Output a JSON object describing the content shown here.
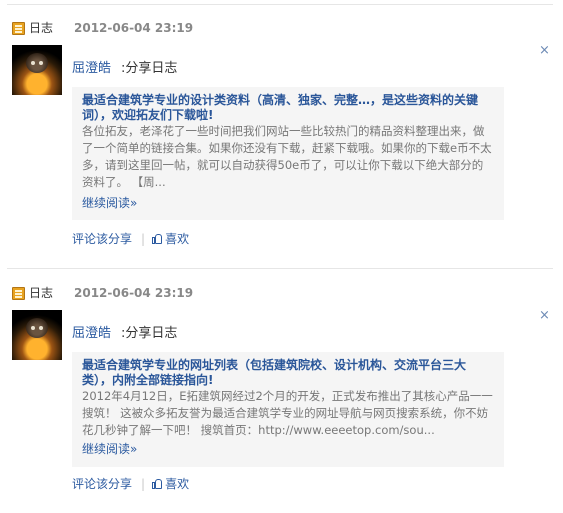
{
  "feed": [
    {
      "type_label": "日志",
      "timestamp": "2012-06-04 23:19",
      "author": "屈澄皓",
      "action": ":分享日志",
      "article_title": "最适合建筑学专业的设计类资料（高清、独家、完整…，是这些资料的关键词），欢迎拓友们下载啦!",
      "article_excerpt": "各位拓友，老泽花了一些时间把我们网站一些比较热门的精品资料整理出来，做了一个简单的链接合集。如果你还没有下载，赶紧下载哦。如果你的下载e币不太多，请到这里回一帖，就可以自动获得50e币了，可以让你下载以下绝大部分的资料了。 【周...",
      "read_more": "继续阅读»",
      "comment_share": "评论该分享",
      "separator": "|",
      "like": "喜欢"
    },
    {
      "type_label": "日志",
      "timestamp": "2012-06-04 23:19",
      "author": "屈澄皓",
      "action": ":分享日志",
      "article_title": "最适合建筑学专业的网址列表（包括建筑院校、设计机构、交流平台三大类），内附全部链接指向!",
      "article_excerpt": "2012年4月12日，E拓建筑网经过2个月的开发，正式发布推出了其核心产品一一搜筑！ 这被众多拓友誉为最适合建筑学专业的网址导航与网页搜索系统，你不妨花几秒钟了解一下吧！ 搜筑首页：http://www.eeeetop.com/sou...",
      "read_more": "继续阅读»",
      "comment_share": "评论该分享",
      "separator": "|",
      "like": "喜欢"
    }
  ],
  "icons": {
    "close": "×",
    "type": "journal-icon",
    "like": "thumbs-up-icon"
  },
  "colors": {
    "link": "#2b5aa0",
    "title": "#2a5699",
    "timestamp": "#888888",
    "box_bg": "#f5f5f5"
  }
}
